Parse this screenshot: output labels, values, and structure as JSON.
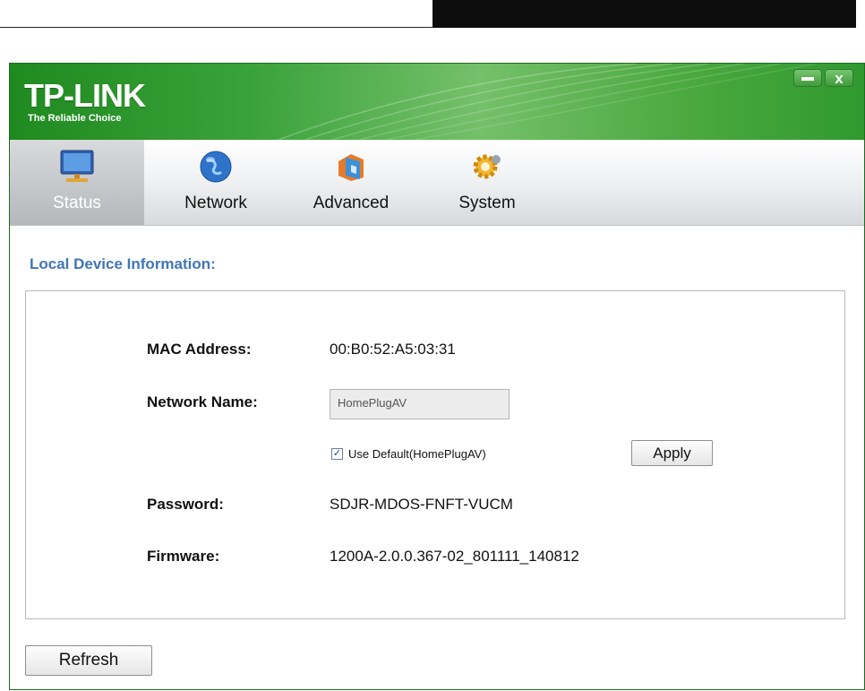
{
  "logo": {
    "name": "TP-LINK",
    "tagline": "The Reliable Choice"
  },
  "window_controls": {
    "minimize": "–",
    "close": "x"
  },
  "tabs": [
    {
      "label": "Status",
      "icon": "monitor-icon",
      "active": true
    },
    {
      "label": "Network",
      "icon": "globe-icon",
      "active": false
    },
    {
      "label": "Advanced",
      "icon": "advanced-icon",
      "active": false
    },
    {
      "label": "System",
      "icon": "gear-icon",
      "active": false
    }
  ],
  "section_title": "Local Device Information:",
  "device": {
    "mac_label": "MAC  Address:",
    "mac_value": "00:B0:52:A5:03:31",
    "network_name_label": "Network Name:",
    "network_name_value": "HomePlugAV",
    "use_default_label": "Use Default(HomePlugAV)",
    "use_default_checked": true,
    "apply_label": "Apply",
    "password_label": "Password:",
    "password_value": "SDJR-MDOS-FNFT-VUCM",
    "firmware_label": "Firmware:",
    "firmware_value": "1200A-2.0.0.367-02_801111_140812"
  },
  "refresh_label": "Refresh",
  "colors": {
    "brand_green": "#2f9a2f",
    "section_title": "#3f76b6"
  }
}
